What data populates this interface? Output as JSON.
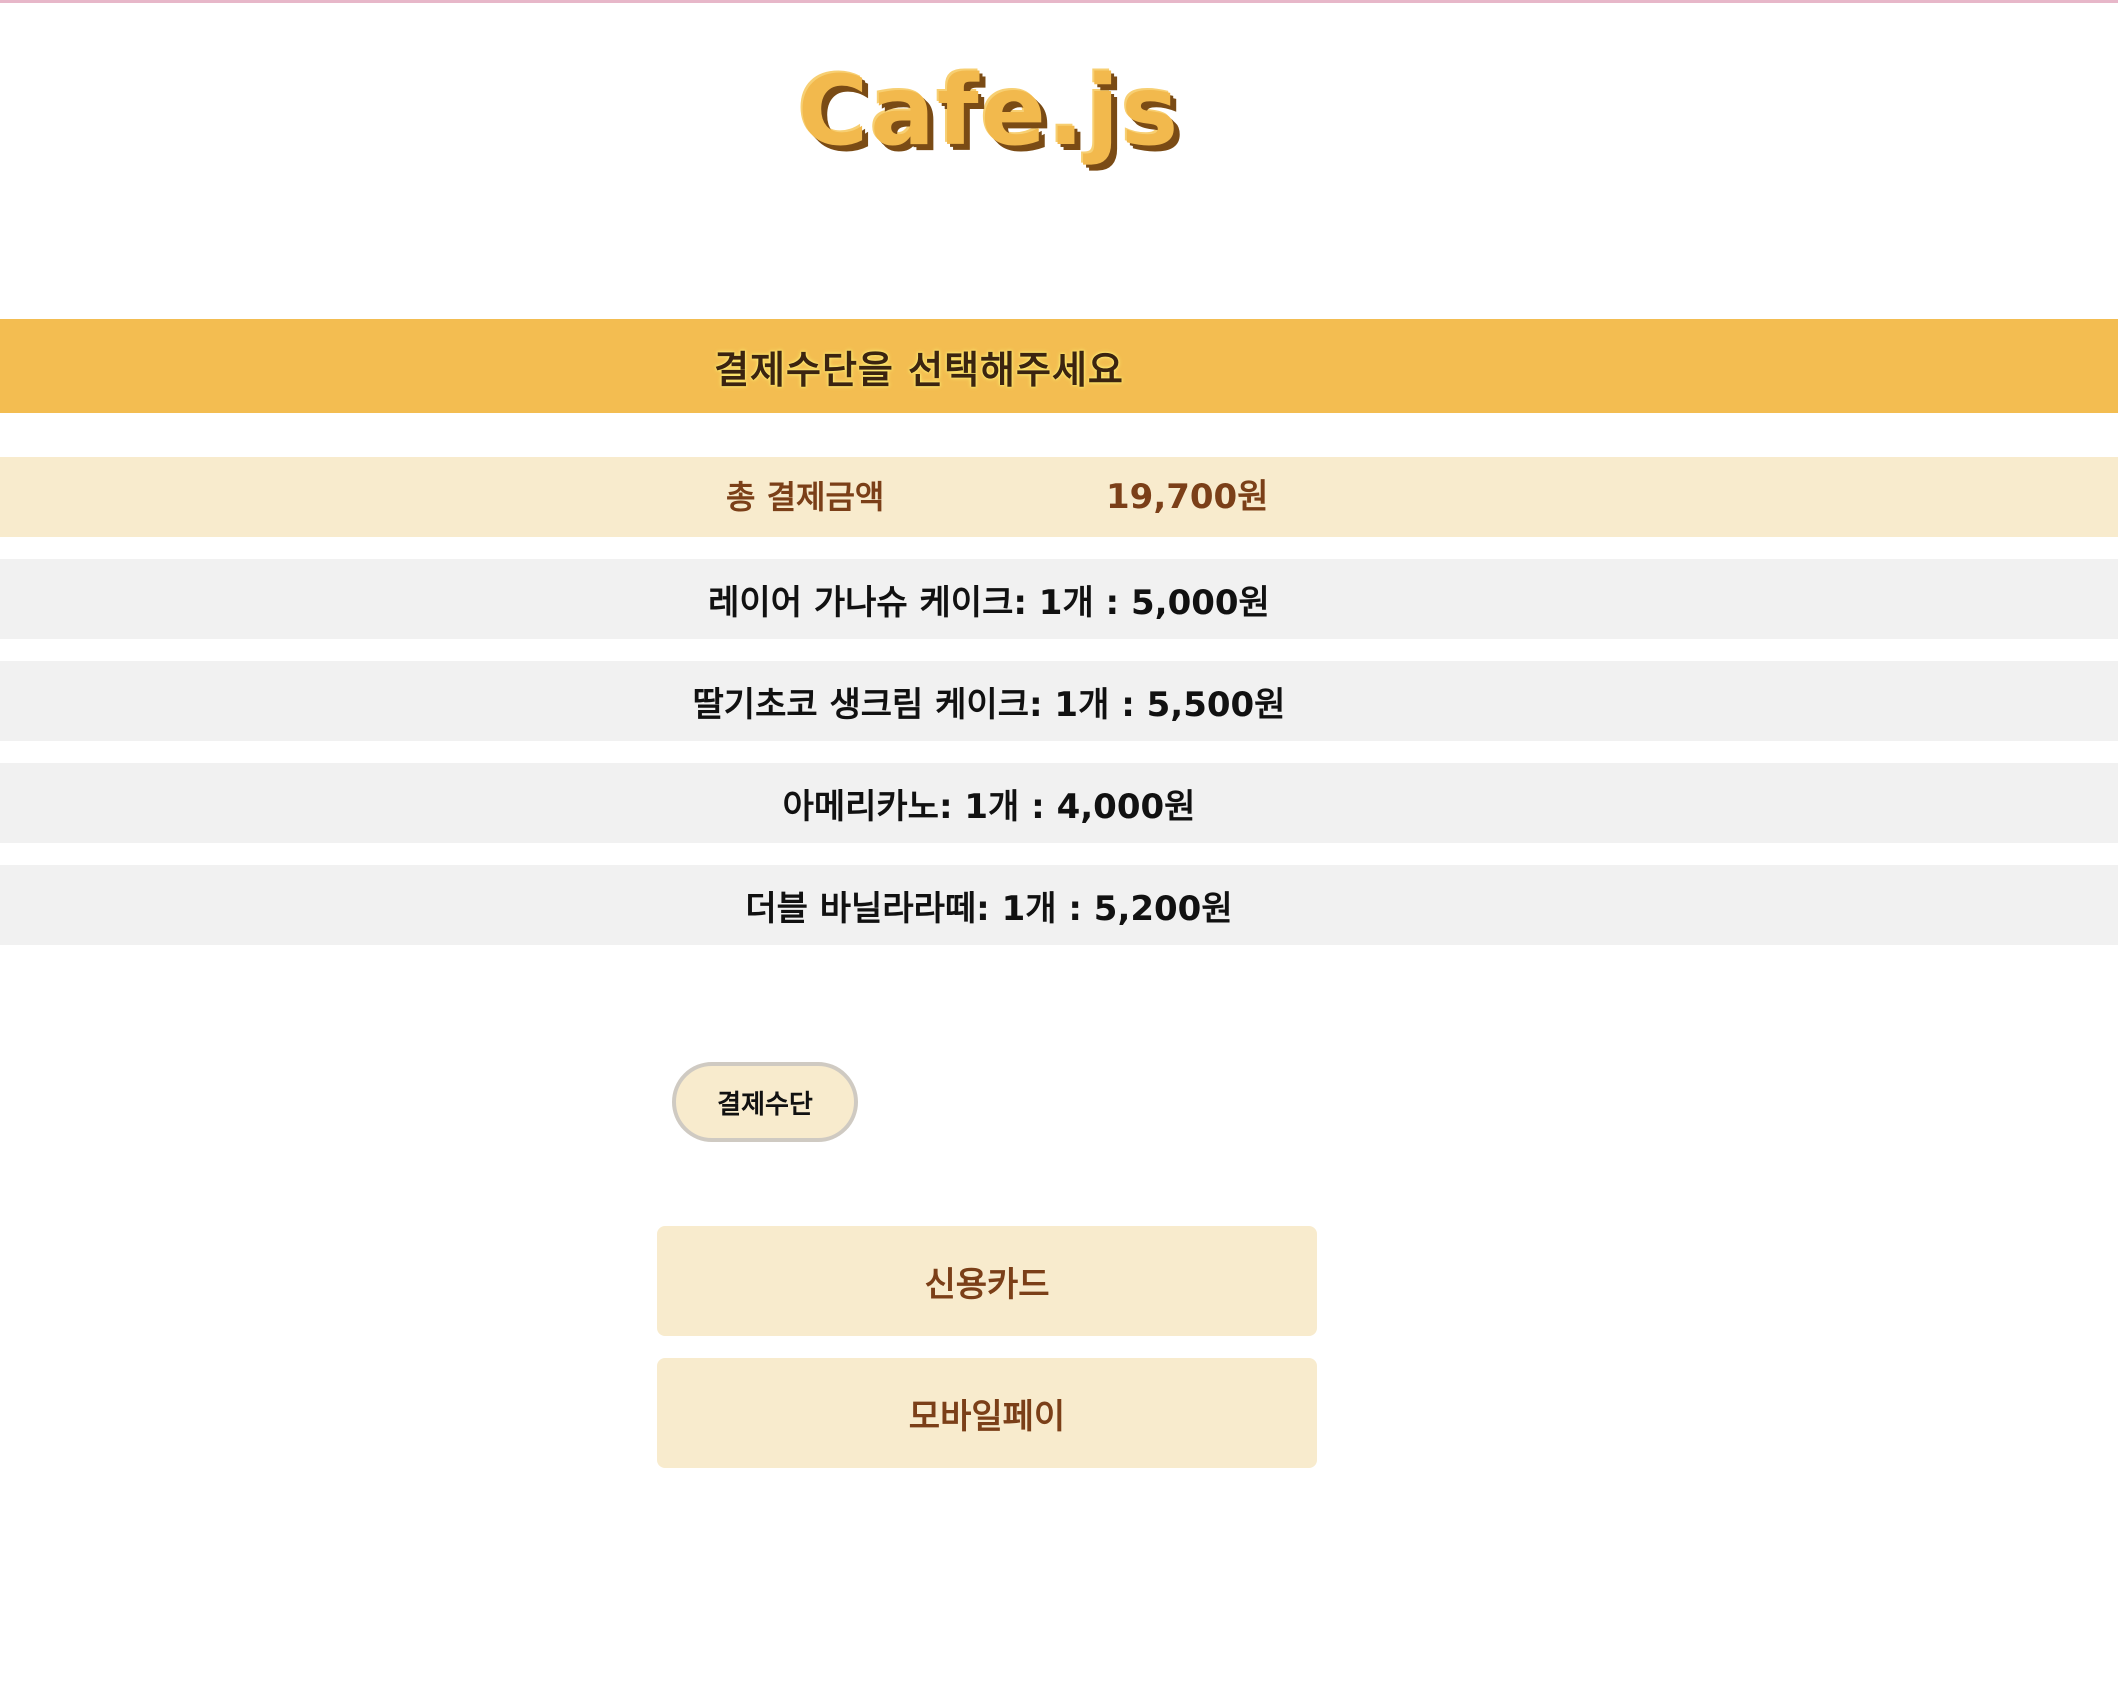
{
  "logo": {
    "text": "Cafe.js"
  },
  "header": {
    "title": "결제수단을 선택해주세요"
  },
  "total": {
    "label": "총 결제금액",
    "value": "19,700원"
  },
  "order_items": [
    "레이어 가나슈 케이크: 1개 : 5,000원",
    "딸기초코 생크림 케이크: 1개 : 5,500원",
    "아메리카노: 1개 : 4,000원",
    "더블 바닐라라떼: 1개 : 5,200원"
  ],
  "payment": {
    "toggle_label": "결제수단",
    "methods": [
      "신용카드",
      "모바일페이"
    ]
  },
  "colors": {
    "header_bg": "#f3bd51",
    "total_bg": "#f8ebcd",
    "row_bg": "#f1f1f1",
    "accent_text": "#7b3f18"
  }
}
